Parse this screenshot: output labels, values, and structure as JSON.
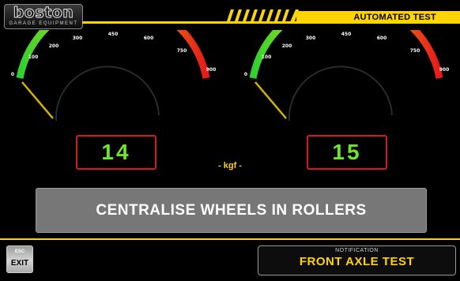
{
  "brand": {
    "name": "boston",
    "subtitle": "GARAGE EQUIPMENT"
  },
  "header": {
    "title": "AUTOMATED TEST"
  },
  "gauges": {
    "ticks": [
      "0",
      "100",
      "200",
      "300",
      "450",
      "600",
      "750",
      "900"
    ],
    "max": 900,
    "left": {
      "reading": 14
    },
    "right": {
      "reading": 15
    }
  },
  "readouts": {
    "left": "14",
    "right": "15",
    "unit": "- kgf -"
  },
  "instruction": "CENTRALISE WHEELS IN ROLLERS",
  "footer": {
    "esc_label": "ESC",
    "exit_label": "EXIT",
    "notification_label": "NOTIFICATION",
    "notification_value": "FRONT AXLE TEST"
  },
  "colors": {
    "accent": "#ffd400",
    "readout_text": "#6ee52b",
    "readout_border": "#d21b1b"
  }
}
